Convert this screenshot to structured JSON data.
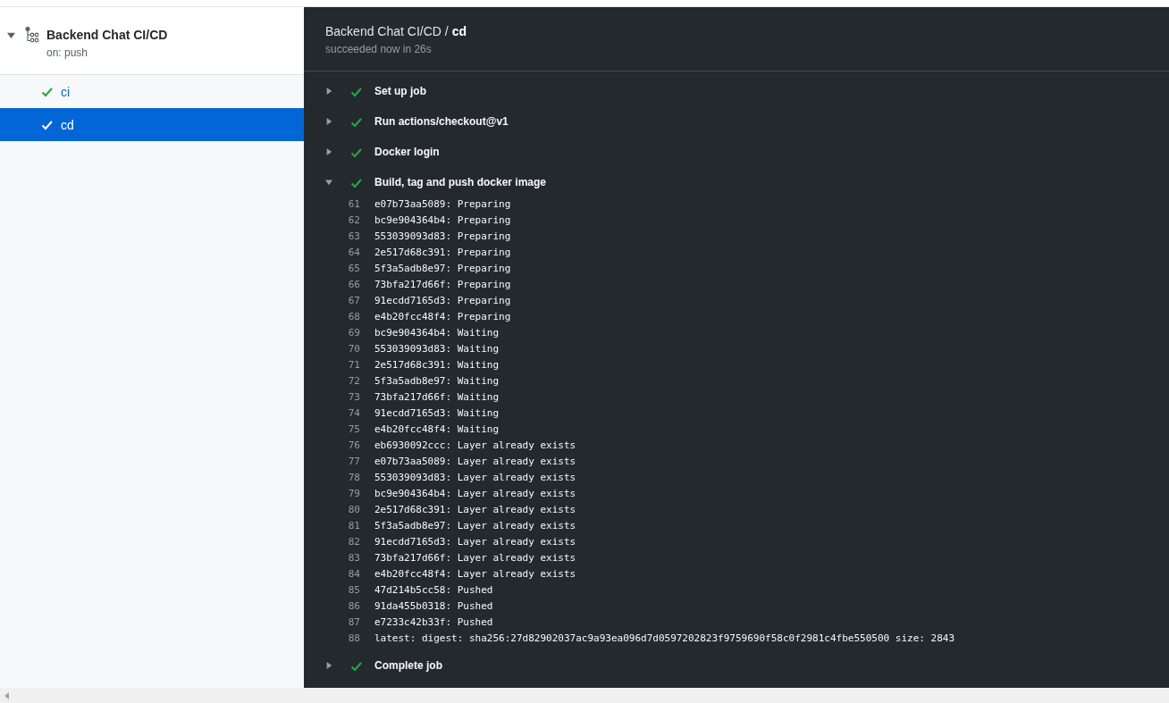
{
  "workflow": {
    "title": "Backend Chat CI/CD",
    "trigger": "on: push",
    "expanded": true
  },
  "jobs": [
    {
      "name": "ci",
      "selected": false,
      "succeeded": true
    },
    {
      "name": "cd",
      "selected": true,
      "succeeded": true
    }
  ],
  "header": {
    "workflow": "Backend Chat CI/CD",
    "separator": "/",
    "job": "cd",
    "summary": "succeeded now in 26s"
  },
  "steps": [
    {
      "name": "Set up job",
      "succeeded": true,
      "expanded": false
    },
    {
      "name": "Run actions/checkout@v1",
      "succeeded": true,
      "expanded": false
    },
    {
      "name": "Docker login",
      "succeeded": true,
      "expanded": false
    },
    {
      "name": "Build, tag and push docker image",
      "succeeded": true,
      "expanded": true,
      "log": [
        {
          "number": "61",
          "text": "e07b73aa5089: Preparing"
        },
        {
          "number": "62",
          "text": "bc9e904364b4: Preparing"
        },
        {
          "number": "63",
          "text": "553039093d83: Preparing"
        },
        {
          "number": "64",
          "text": "2e517d68c391: Preparing"
        },
        {
          "number": "65",
          "text": "5f3a5adb8e97: Preparing"
        },
        {
          "number": "66",
          "text": "73bfa217d66f: Preparing"
        },
        {
          "number": "67",
          "text": "91ecdd7165d3: Preparing"
        },
        {
          "number": "68",
          "text": "e4b20fcc48f4: Preparing"
        },
        {
          "number": "69",
          "text": "bc9e904364b4: Waiting"
        },
        {
          "number": "70",
          "text": "553039093d83: Waiting"
        },
        {
          "number": "71",
          "text": "2e517d68c391: Waiting"
        },
        {
          "number": "72",
          "text": "5f3a5adb8e97: Waiting"
        },
        {
          "number": "73",
          "text": "73bfa217d66f: Waiting"
        },
        {
          "number": "74",
          "text": "91ecdd7165d3: Waiting"
        },
        {
          "number": "75",
          "text": "e4b20fcc48f4: Waiting"
        },
        {
          "number": "76",
          "text": "eb6930092ccc: Layer already exists"
        },
        {
          "number": "77",
          "text": "e07b73aa5089: Layer already exists"
        },
        {
          "number": "78",
          "text": "553039093d83: Layer already exists"
        },
        {
          "number": "79",
          "text": "bc9e904364b4: Layer already exists"
        },
        {
          "number": "80",
          "text": "2e517d68c391: Layer already exists"
        },
        {
          "number": "81",
          "text": "5f3a5adb8e97: Layer already exists"
        },
        {
          "number": "82",
          "text": "91ecdd7165d3: Layer already exists"
        },
        {
          "number": "83",
          "text": "73bfa217d66f: Layer already exists"
        },
        {
          "number": "84",
          "text": "e4b20fcc48f4: Layer already exists"
        },
        {
          "number": "85",
          "text": "47d214b5cc58: Pushed"
        },
        {
          "number": "86",
          "text": "91da455b0318: Pushed"
        },
        {
          "number": "87",
          "text": "e7233c42b33f: Pushed"
        },
        {
          "number": "88",
          "text": "latest: digest: sha256:27d82902037ac9a93ea096d7d0597202823f9759690f58c0f2981c4fbe550500 size: 2843"
        }
      ]
    },
    {
      "name": "Complete job",
      "succeeded": true,
      "expanded": false
    }
  ]
}
